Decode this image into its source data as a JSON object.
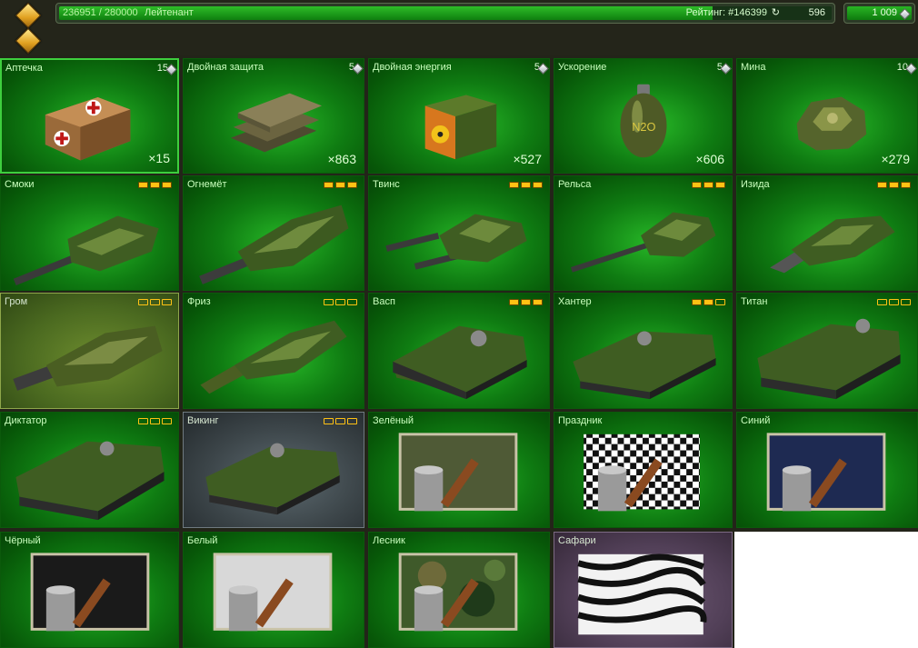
{
  "header": {
    "score": "236951 / 280000",
    "score_fraction": 0.846,
    "rank_title": "Лейтенант",
    "rating": "Рейтинг: #146399",
    "rating_icon": "rating-change-icon",
    "rating_change": "596",
    "crystals": "1 009"
  },
  "colors": {
    "tile_green": "#0f7c12",
    "tile_border": "#0b5a0b",
    "selected_border": "#3ecf3e",
    "text_green": "#caffbe",
    "modification_gold": "#ffc214",
    "topbar_bg": "#24251a"
  },
  "tiles": [
    {
      "name": "Аптечка",
      "price": "15",
      "qty": "×15",
      "icon": "first-aid-kit-icon"
    },
    {
      "name": "Двойная защита",
      "price": "5",
      "qty": "×863",
      "icon": "double-armor-icon"
    },
    {
      "name": "Двойная энергия",
      "price": "5",
      "qty": "×527",
      "icon": "double-damage-icon"
    },
    {
      "name": "Ускорение",
      "price": "5",
      "qty": "×606",
      "icon": "nitro-icon"
    },
    {
      "name": "Мина",
      "price": "10",
      "qty": "×279",
      "icon": "mine-icon"
    },
    {
      "name": "Смоки",
      "icon": "smoky-turret-icon"
    },
    {
      "name": "Огнемёт",
      "icon": "firebird-turret-icon"
    },
    {
      "name": "Твинс",
      "icon": "twins-turret-icon"
    },
    {
      "name": "Рельса",
      "icon": "railgun-turret-icon"
    },
    {
      "name": "Изида",
      "icon": "isida-turret-icon"
    },
    {
      "name": "Гром",
      "icon": "thunder-turret-icon"
    },
    {
      "name": "Фриз",
      "icon": "freeze-turret-icon"
    },
    {
      "name": "Васп",
      "icon": "wasp-hull-icon"
    },
    {
      "name": "Хантер",
      "icon": "hunter-hull-icon"
    },
    {
      "name": "Титан",
      "icon": "titan-hull-icon"
    },
    {
      "name": "Диктатор",
      "icon": "dictator-hull-icon"
    },
    {
      "name": "Викинг",
      "icon": "viking-hull-icon"
    },
    {
      "name": "Зелёный",
      "icon": "paint-green-icon"
    },
    {
      "name": "Праздник",
      "icon": "paint-holiday-icon"
    },
    {
      "name": "Синий",
      "icon": "paint-blue-icon"
    },
    {
      "name": "Чёрный",
      "icon": "paint-black-icon"
    },
    {
      "name": "Белый",
      "icon": "paint-white-icon"
    },
    {
      "name": "Лесник",
      "icon": "paint-forester-icon"
    },
    {
      "name": "Сафари",
      "icon": "paint-safari-icon"
    }
  ]
}
